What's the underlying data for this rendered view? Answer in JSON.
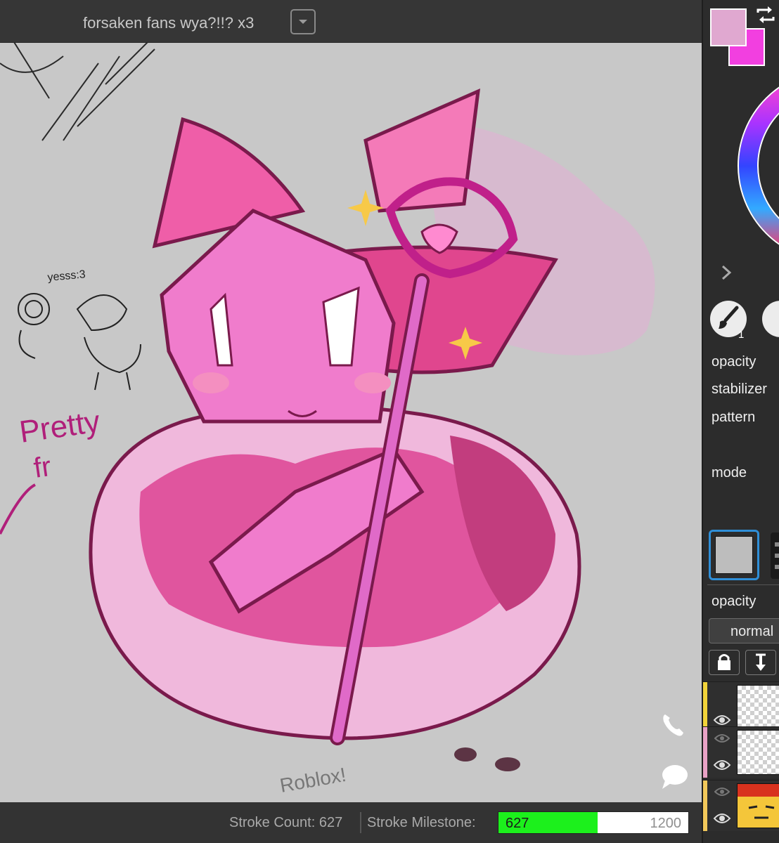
{
  "room": {
    "title": "forsaken fans wya?!!? x3"
  },
  "canvas": {
    "doodle_texts": [
      "Pretty",
      "fr",
      "yesss:3",
      "Roblox!"
    ],
    "buttons": {
      "call_icon": "phone-icon",
      "chat_icon": "chat-bubble-icon"
    }
  },
  "status": {
    "stroke_count_label": "Stroke Count: 627",
    "milestone_label": "Stroke Milestone:",
    "milestone_current": "627",
    "milestone_max": "1200",
    "milestone_fraction": 0.5225,
    "progress_color": "#1cf01c"
  },
  "panel": {
    "primary_color": "#e0a8d0",
    "secondary_color": "#f23fe0",
    "brush_size": "1",
    "brush_labels": {
      "opacity": "opacity",
      "stabilizer": "stabilizer",
      "pattern": "pattern",
      "mode": "mode"
    },
    "layer_opacity_label": "opacity",
    "blend_mode": "normal",
    "layer_tag_colors": [
      "#f2d43a",
      "#e9a2c6",
      "#f2c85a"
    ]
  }
}
